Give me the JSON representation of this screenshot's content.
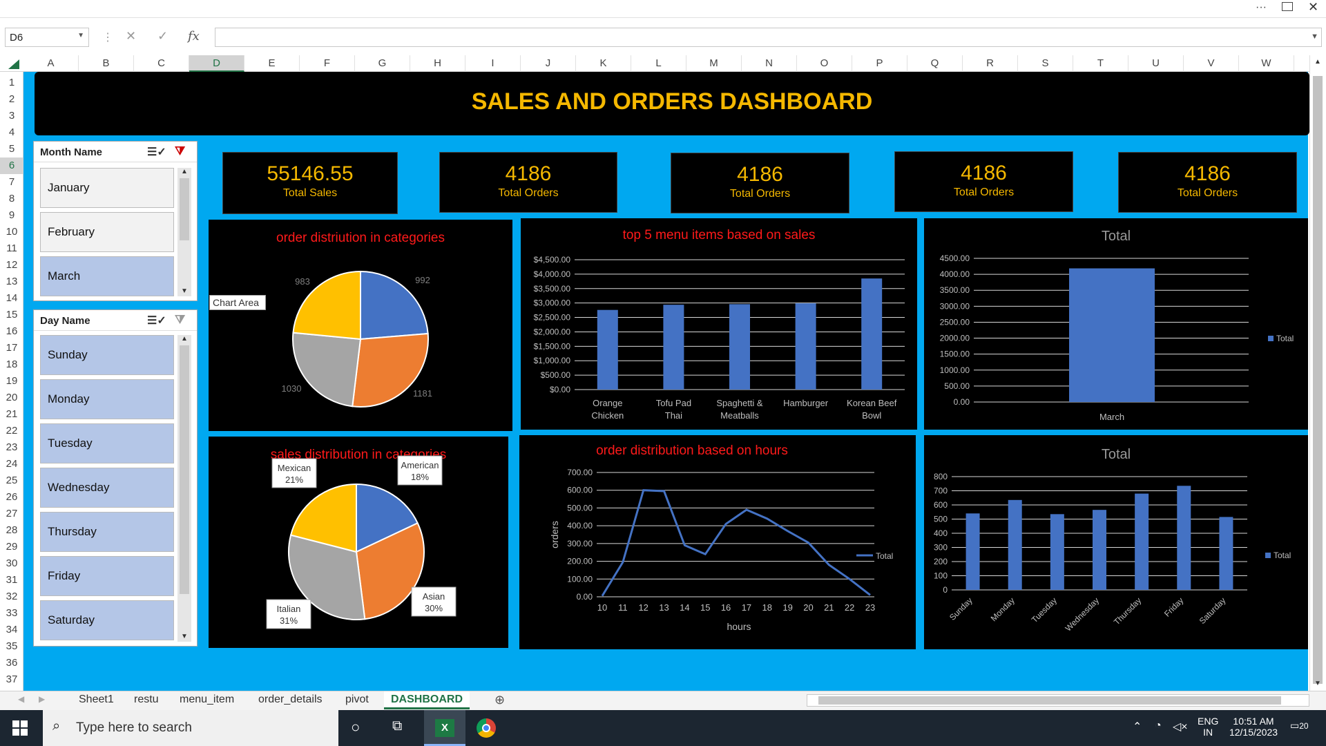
{
  "window": {
    "controls": [
      "...",
      "restore",
      "close"
    ]
  },
  "formula_bar": {
    "name_box": "D6",
    "fx_label": "fx",
    "formula": ""
  },
  "columns": [
    "A",
    "B",
    "C",
    "D",
    "E",
    "F",
    "G",
    "H",
    "I",
    "J",
    "K",
    "L",
    "M",
    "N",
    "O",
    "P",
    "Q",
    "R",
    "S",
    "T",
    "U",
    "V",
    "W"
  ],
  "selected_column": "D",
  "rows": [
    "1",
    "2",
    "3",
    "4",
    "5",
    "6",
    "7",
    "8",
    "9",
    "10",
    "11",
    "12",
    "13",
    "14",
    "15",
    "16",
    "17",
    "18",
    "19",
    "20",
    "21",
    "22",
    "23",
    "24",
    "25",
    "26",
    "27",
    "28",
    "29",
    "30",
    "31",
    "32",
    "33",
    "34",
    "35",
    "36",
    "37"
  ],
  "selected_row": "6",
  "dashboard": {
    "title": "SALES AND ORDERS DASHBOARD",
    "chart_area_tooltip": "Chart Area"
  },
  "kpis": [
    {
      "value": "55146.55",
      "label": "Total Sales"
    },
    {
      "value": "4186",
      "label": "Total Orders"
    },
    {
      "value": "4186",
      "label": "Total Orders"
    },
    {
      "value": "4186",
      "label": "Total Orders"
    },
    {
      "value": "4186",
      "label": "Total Orders"
    }
  ],
  "slicers": {
    "month": {
      "title": "Month Name",
      "items": [
        "January",
        "February",
        "March"
      ],
      "selected": "March"
    },
    "day": {
      "title": "Day Name",
      "items": [
        "Sunday",
        "Monday",
        "Tuesday",
        "Wednesday",
        "Thursday",
        "Friday",
        "Saturday"
      ]
    }
  },
  "chart_data": [
    {
      "type": "pie",
      "title": "order distriution in categories",
      "labels": [
        "992",
        "1181",
        "1030",
        "983"
      ],
      "values": [
        992,
        1181,
        1030,
        983
      ],
      "colors": [
        "#4472c4",
        "#ed7d31",
        "#a5a5a5",
        "#ffc000"
      ]
    },
    {
      "type": "bar",
      "title": "top 5 menu items based on sales",
      "categories": [
        "Orange Chicken",
        "Tofu Pad Thai",
        "Spaghetti & Meatballs",
        "Hamburger",
        "Korean Beef Bowl"
      ],
      "values": [
        2760,
        2940,
        2960,
        2990,
        3850
      ],
      "yticks": [
        "$0.00",
        "$500.00",
        "$1,000.00",
        "$1,500.00",
        "$2,000.00",
        "$2,500.00",
        "$3,000.00",
        "$3,500.00",
        "$4,000.00",
        "$4,500.00"
      ],
      "ylim": [
        0,
        4500
      ]
    },
    {
      "type": "bar",
      "title": "Total",
      "categories": [
        "March"
      ],
      "values": [
        4186
      ],
      "yticks": [
        "0.00",
        "500.00",
        "1000.00",
        "1500.00",
        "2000.00",
        "2500.00",
        "3000.00",
        "3500.00",
        "4000.00",
        "4500.00"
      ],
      "ylim": [
        0,
        4500
      ],
      "legend": "Total"
    },
    {
      "type": "pie",
      "title": "sales distribution in categories",
      "labels": [
        {
          "name": "American",
          "pct": "18%"
        },
        {
          "name": "Asian",
          "pct": "30%"
        },
        {
          "name": "Italian",
          "pct": "31%"
        },
        {
          "name": "Mexican",
          "pct": "21%"
        }
      ],
      "values": [
        18,
        30,
        31,
        21
      ],
      "colors": [
        "#4472c4",
        "#ed7d31",
        "#a5a5a5",
        "#ffc000"
      ]
    },
    {
      "type": "line",
      "title": "order distribution based on hours",
      "x": [
        "10",
        "11",
        "12",
        "13",
        "14",
        "15",
        "16",
        "17",
        "18",
        "19",
        "20",
        "21",
        "22",
        "23"
      ],
      "values": [
        5,
        195,
        600,
        595,
        290,
        240,
        410,
        490,
        440,
        370,
        305,
        180,
        100,
        10
      ],
      "yticks": [
        "0.00",
        "100.00",
        "200.00",
        "300.00",
        "400.00",
        "500.00",
        "600.00",
        "700.00"
      ],
      "ylim": [
        0,
        700
      ],
      "xlabel": "hours",
      "ylabel": "orders",
      "legend": "Total"
    },
    {
      "type": "bar",
      "title": "Total",
      "categories": [
        "Sunday",
        "Monday",
        "Tuesday",
        "Wednesday",
        "Thursday",
        "Friday",
        "Saturday"
      ],
      "values": [
        540,
        635,
        535,
        565,
        680,
        735,
        515
      ],
      "yticks": [
        "0",
        "100",
        "200",
        "300",
        "400",
        "500",
        "600",
        "700",
        "800"
      ],
      "ylim": [
        0,
        800
      ],
      "legend": "Total"
    }
  ],
  "sheet_tabs": [
    "Sheet1",
    "restu",
    "menu_item",
    "order_details",
    "pivot",
    "DASHBOARD"
  ],
  "active_tab": "DASHBOARD",
  "taskbar": {
    "search_placeholder": "Type here to search",
    "lang1": "ENG",
    "lang2": "IN",
    "time": "10:51 AM",
    "date": "12/15/2023",
    "notif": "20"
  },
  "colors": {
    "sheet_bg": "#00a8f0",
    "title": "#f5b800",
    "chart_title": "#ff1a1a",
    "bar": "#4472c4"
  }
}
